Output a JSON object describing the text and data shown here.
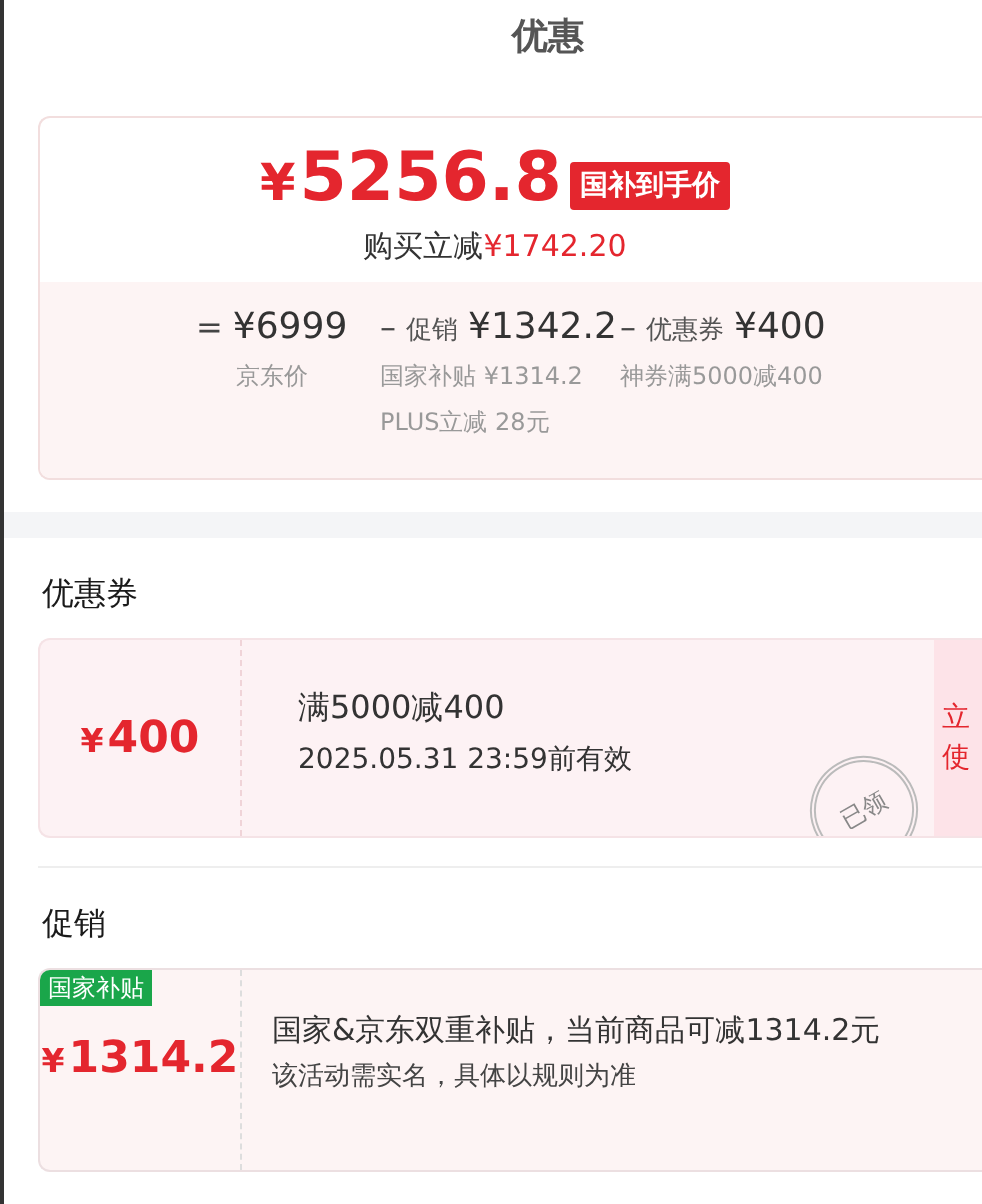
{
  "header": {
    "title": "优惠"
  },
  "summary": {
    "price": "¥5256.8",
    "badge": "国补到手价",
    "saving_label": "购买立减",
    "saving_amount": "¥1742.20",
    "columns": [
      {
        "sign": "=",
        "amount": "¥6999",
        "notes": [
          "京东价"
        ]
      },
      {
        "sign": "–",
        "label": "促销",
        "amount": "¥1342.2",
        "notes": [
          "国家补贴 ¥1314.2",
          "PLUS立减 28元"
        ]
      },
      {
        "sign": "–",
        "label": "优惠券",
        "amount": "¥400",
        "notes": [
          "神券满5000减400"
        ]
      }
    ]
  },
  "coupons": {
    "title": "优惠券",
    "items": [
      {
        "amount": "¥400",
        "condition": "满5000减400",
        "validity": "2025.05.31 23:59前有效",
        "claimed": true,
        "stamp": "已领",
        "action_lines": [
          "立",
          "使"
        ]
      }
    ]
  },
  "promotions": {
    "title": "促销",
    "items": [
      {
        "tag": "国家补贴",
        "amount": "¥1314.2",
        "description": "国家&京东双重补贴，当前商品可减1314.2元",
        "note": "该活动需实名，具体以规则为准"
      }
    ]
  }
}
